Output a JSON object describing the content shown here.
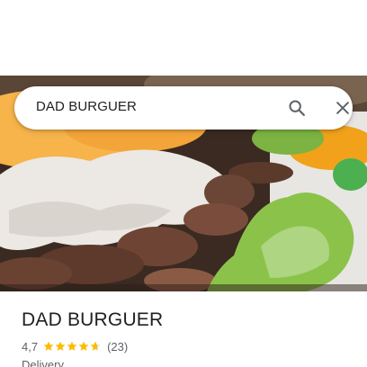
{
  "search": {
    "query": "DAD BURGUER",
    "search_icon": "search-icon",
    "close_icon": "close-icon"
  },
  "place": {
    "name": "DAD BURGUER",
    "rating": "4,7",
    "rating_value": 4.7,
    "review_count": "(23)",
    "category": "Delivery"
  },
  "colors": {
    "star": "#fbbc04",
    "star_empty": "#dadce0",
    "text_primary": "#202124",
    "text_secondary": "#5f6368"
  }
}
